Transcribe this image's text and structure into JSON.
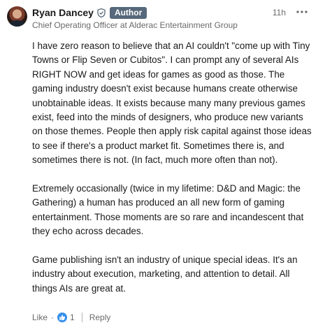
{
  "comment": {
    "author_name": "Ryan Dancey",
    "author_badge": "Author",
    "headline": "Chief Operating Officer at Alderac Entertainment Group",
    "time": "11h",
    "paragraphs": [
      "I have zero reason to believe that an AI couldn't \"come up with Tiny Towns or Flip Seven or Cubitos\". I can prompt any of several AIs RIGHT NOW and get ideas for games as good as those. The gaming industry doesn't exist because humans create otherwise unobtainable ideas. It exists because many many previous games exist, feed into the minds of designers, who produce new variants on those themes. People then apply risk capital against those ideas to see if there's a product market fit. Sometimes there is, and sometimes there is not. (In fact, much more often than not).",
      "Extremely occasionally (twice in my lifetime: D&D and Magic: the Gathering) a human has produced an all new form of gaming entertainment. Those moments are so rare and incandescent that they echo across decades.",
      "Game publishing isn't an industry of unique special ideas. It's an industry about execution, marketing, and attention to detail. All things AIs are great at."
    ]
  },
  "actions": {
    "like_label": "Like",
    "separator": "·",
    "reaction_count": "1",
    "reply_label": "Reply"
  },
  "icons": {
    "verified": "verified-shield-icon",
    "more": "more-options-icon",
    "reaction": "like-reaction-icon"
  },
  "colors": {
    "badge_bg": "#56687a",
    "reaction_blue": "#378fe9"
  }
}
